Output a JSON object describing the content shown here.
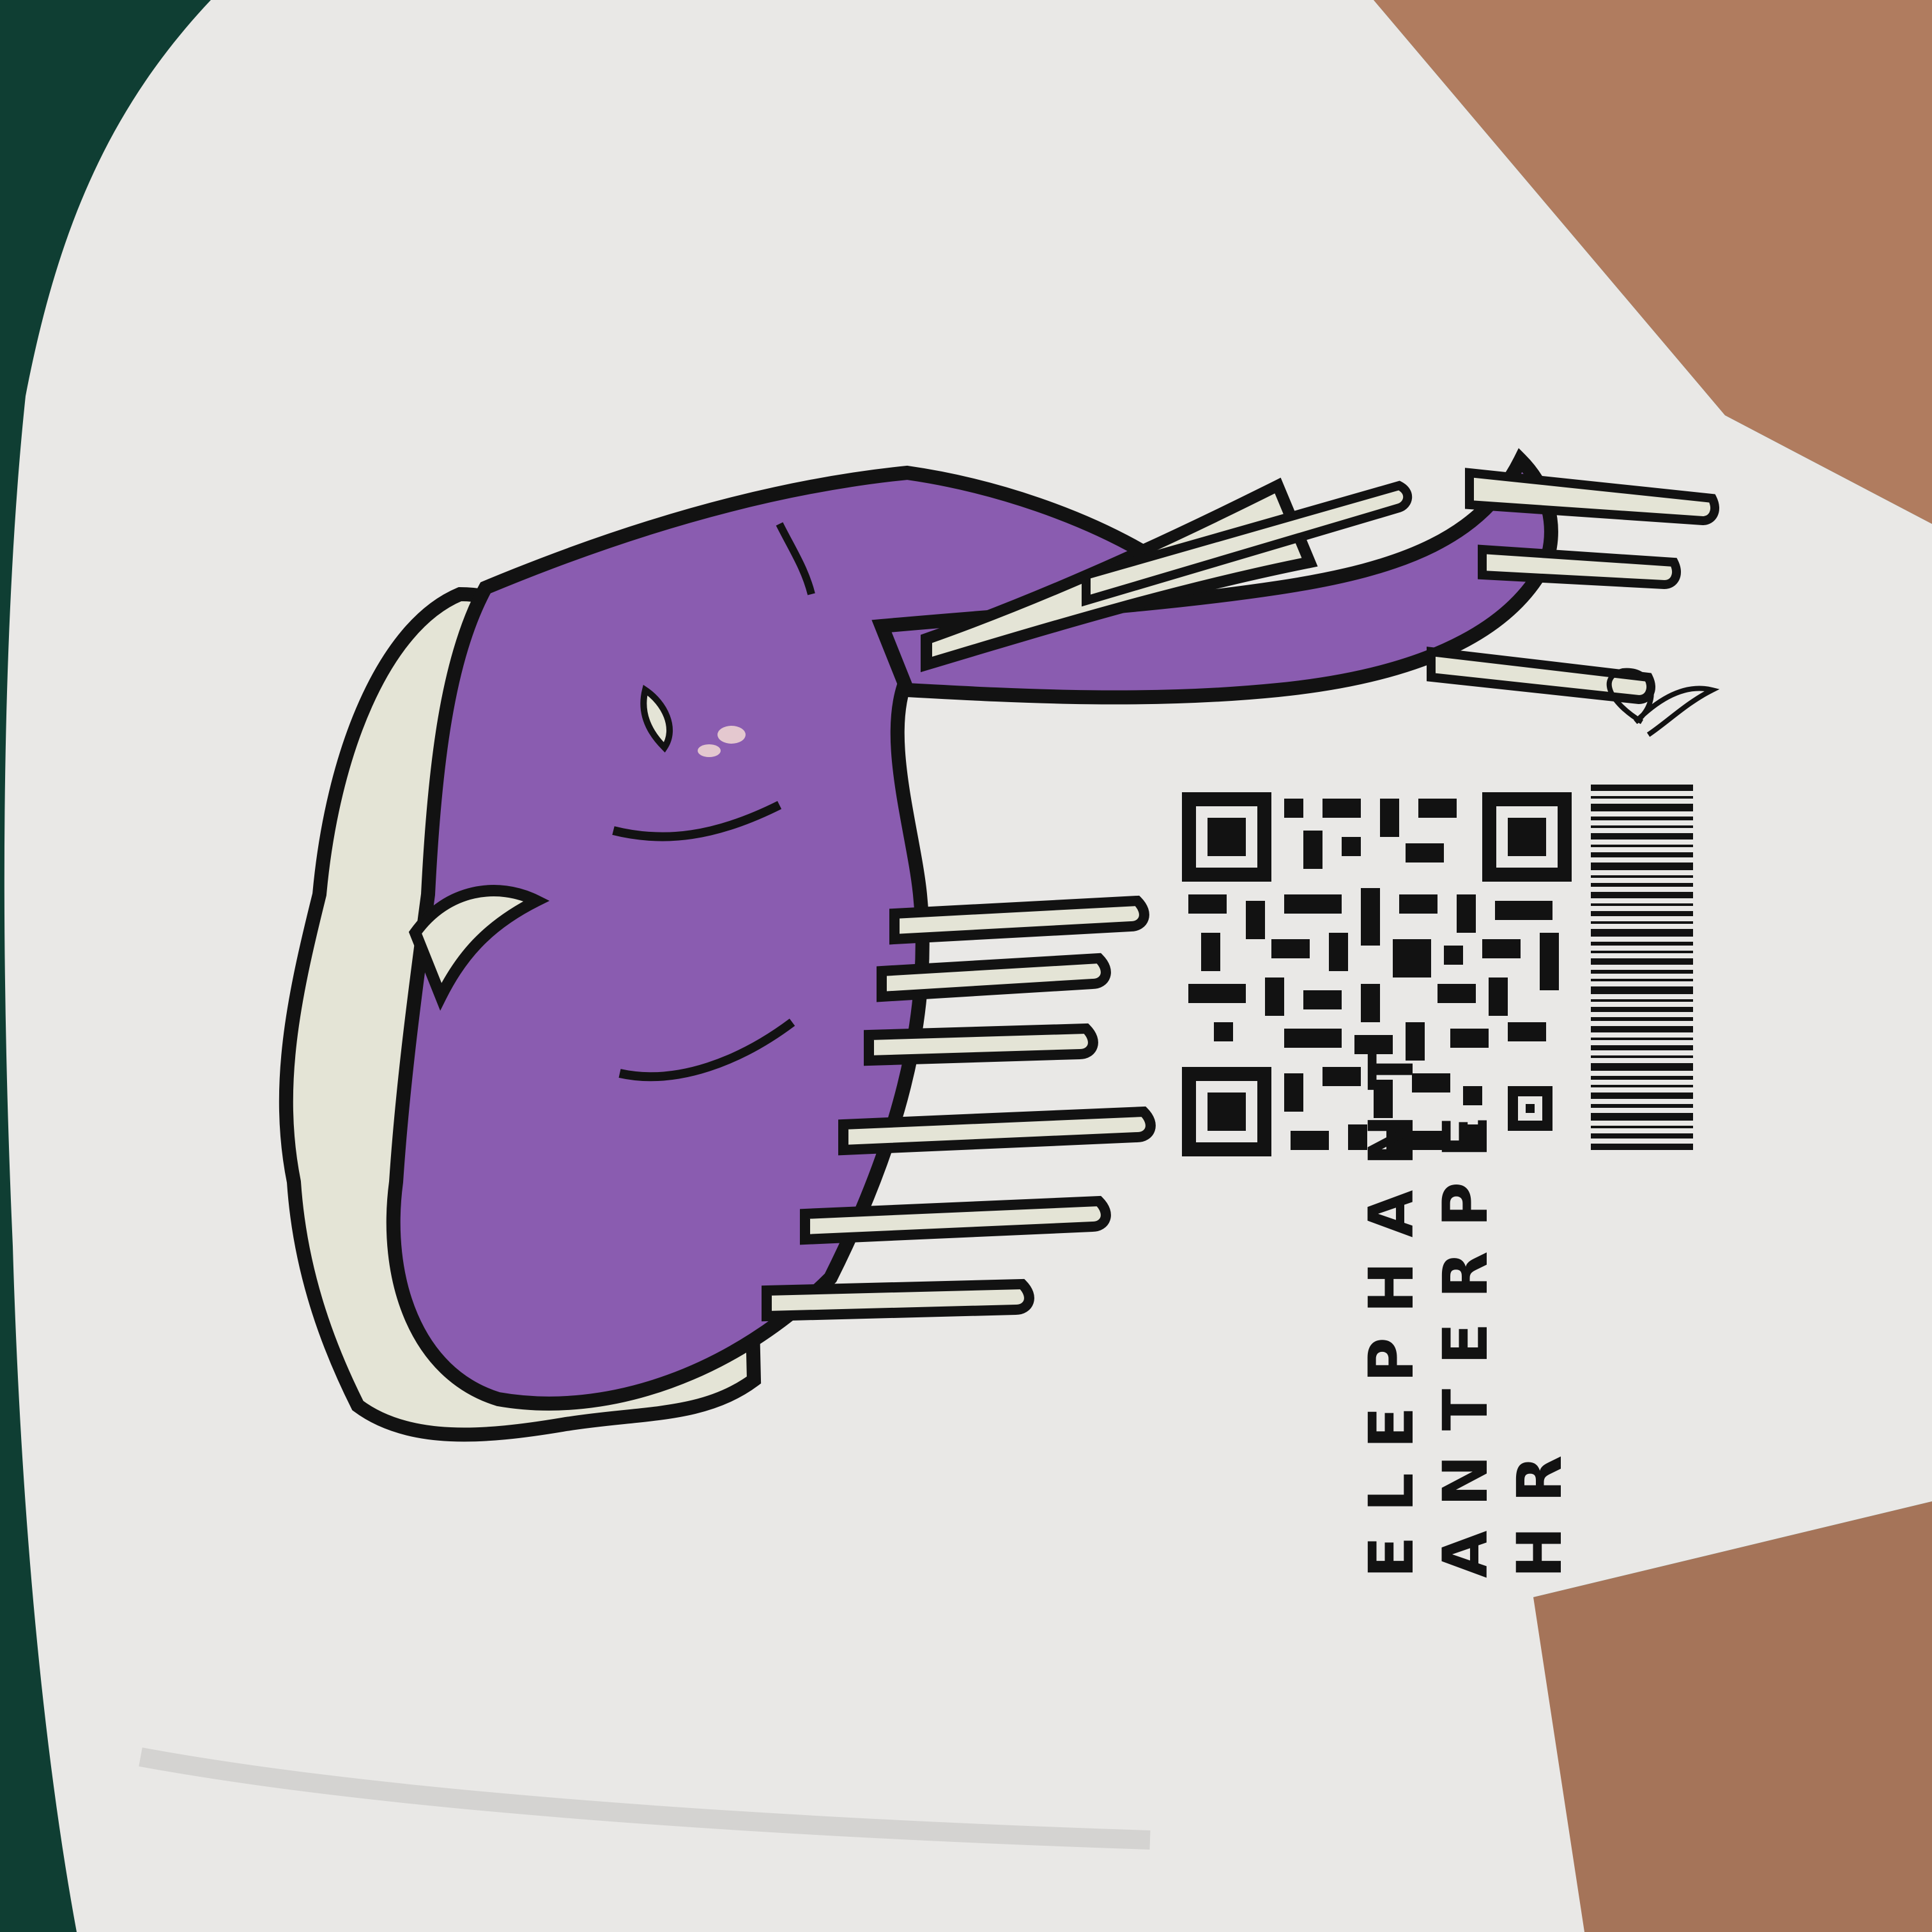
{
  "photo": {
    "subject": "white t-shirt print, photographed rotated",
    "colors": {
      "background": "#0f3e33",
      "shirt": "#e9e8e6",
      "skin": "#b07c5f",
      "elephant": "#8a5cb0",
      "drip": "#e4e4d6",
      "ink": "#121212"
    }
  },
  "print": {
    "text_lines": [
      "ELEPHANT",
      "ANTERPE",
      "HR"
    ]
  },
  "icons": {
    "qr": "qr-code-icon",
    "barcode": "barcode-icon",
    "signature": "signature-mark-icon"
  }
}
